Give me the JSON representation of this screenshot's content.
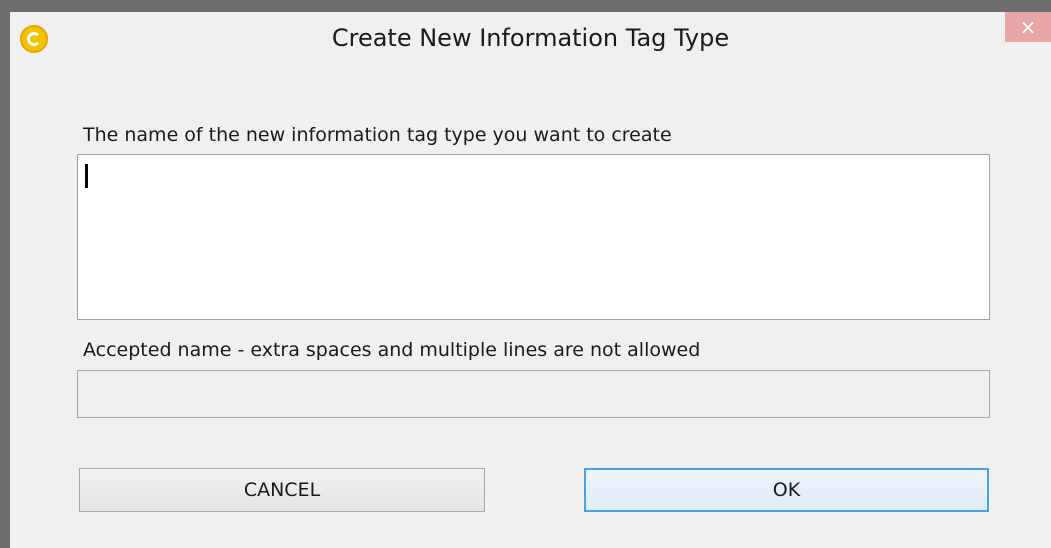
{
  "dialog": {
    "title": "Create New Information Tag Type",
    "close_label": "×",
    "icon": "app-logo-c-icon",
    "name_field": {
      "label": "The name of the new information tag type you want to create",
      "value": ""
    },
    "accepted_field": {
      "label": "Accepted name - extra spaces and multiple lines are not allowed",
      "value": ""
    },
    "buttons": {
      "cancel_label": "CANCEL",
      "ok_label": "OK"
    }
  },
  "colors": {
    "window_bg": "#f0f0f0",
    "frame": "#6e6e6e",
    "close_bg": "#e8a6a6",
    "ok_border": "#4aa3e0",
    "app_icon": "#f3c300"
  }
}
